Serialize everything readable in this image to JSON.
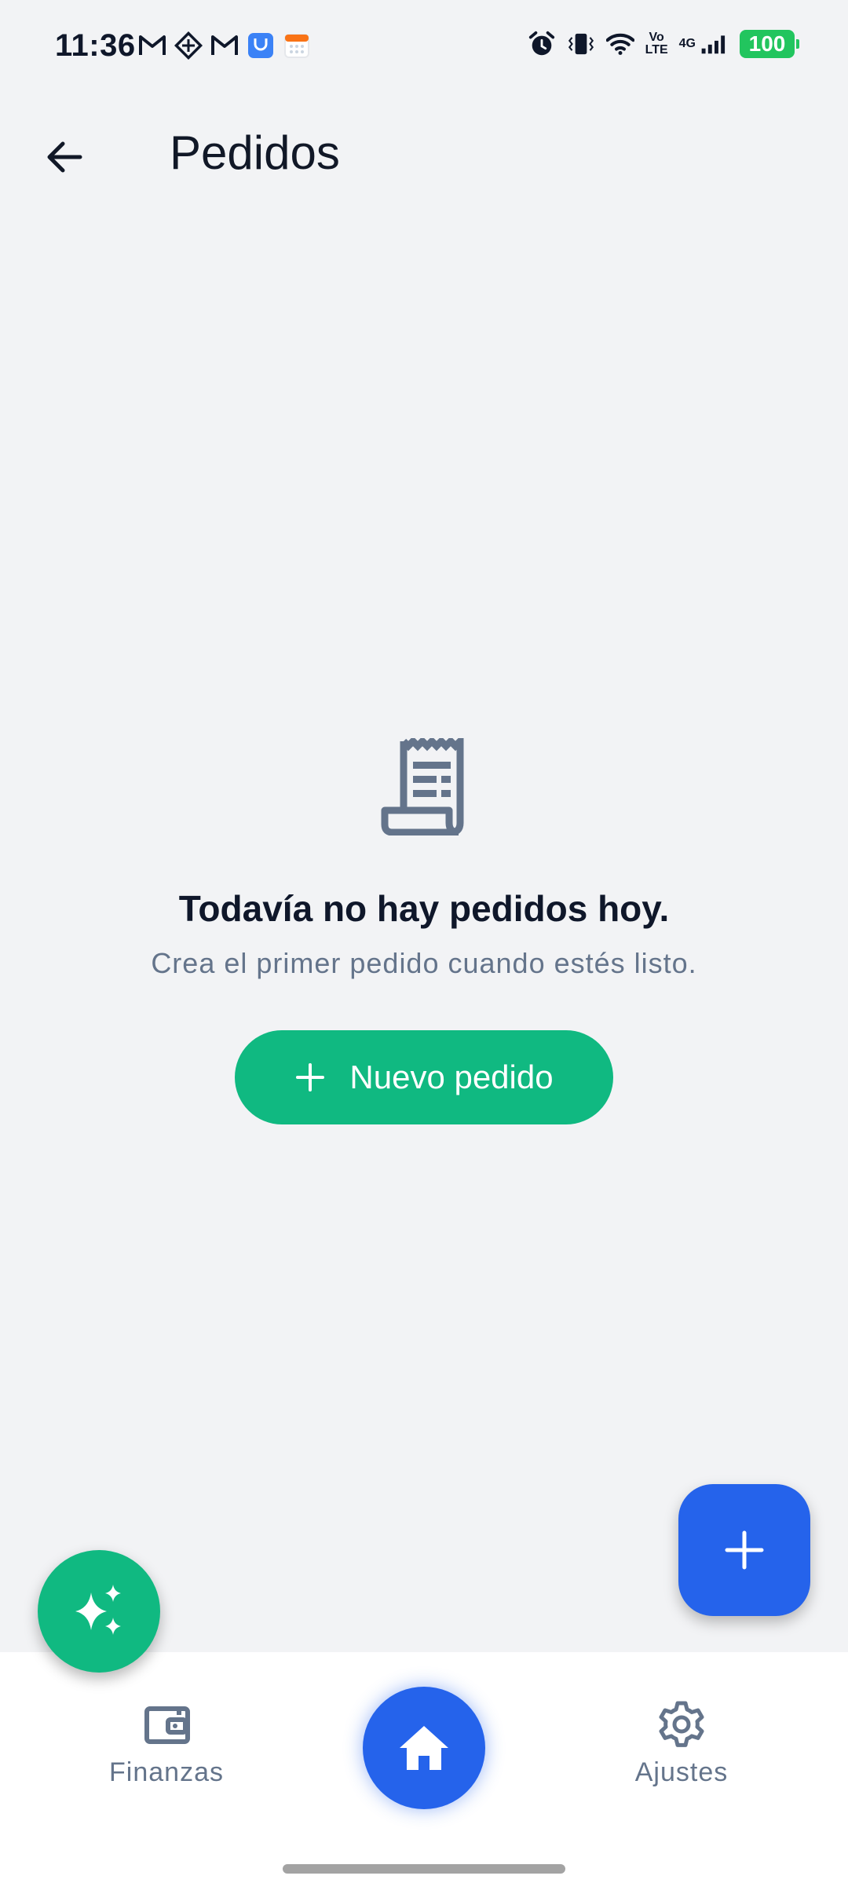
{
  "status_bar": {
    "time": "11:36",
    "left_icons": [
      "gmail-icon",
      "maps-diamond-icon",
      "gmail-icon",
      "pay-market-icon",
      "calendar-icon"
    ],
    "right_icons": [
      "alarm-icon",
      "vibrate-icon",
      "wifi-icon",
      "volte-icon",
      "signal-icon"
    ],
    "volte_line1": "Vo",
    "volte_line2": "LTE",
    "network": "4G",
    "battery": "100",
    "battery_color": "#22c55e"
  },
  "app_bar": {
    "title": "Pedidos",
    "back_icon": "arrow-left-icon"
  },
  "empty_state": {
    "icon": "receipt-icon",
    "title": "Todavía no hay pedidos hoy.",
    "subtitle": "Crea el primer pedido cuando estés listo.",
    "button_icon": "plus-icon",
    "button_label": "Nuevo pedido"
  },
  "fabs": {
    "add_icon": "plus-icon",
    "assistant_icon": "sparkles-icon"
  },
  "bottom_nav": {
    "items": [
      {
        "label": "Finanzas",
        "icon": "wallet-icon"
      },
      {
        "label": "",
        "icon": "home-icon"
      },
      {
        "label": "Ajustes",
        "icon": "gear-icon"
      }
    ]
  },
  "colors": {
    "background": "#f2f3f5",
    "accent_green": "#10b981",
    "accent_blue": "#2563eb",
    "muted_text": "#64748b",
    "icon_gray": "#64748b"
  }
}
